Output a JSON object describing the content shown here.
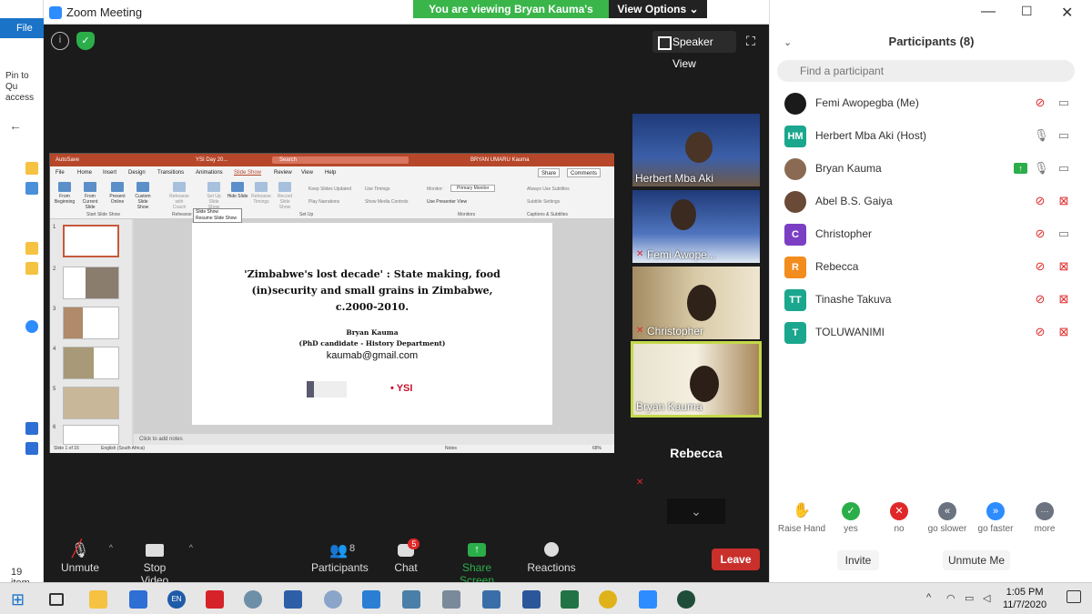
{
  "window": {
    "title": "Zoom Meeting",
    "viewing_banner": "You are viewing Bryan Kauma's screen",
    "view_options": "View Options"
  },
  "explorer": {
    "file_tab": "File",
    "pin_label": "Pin to Qu access",
    "items_count": "19 item"
  },
  "stage": {
    "speaker_view": "Speaker View"
  },
  "ppt": {
    "autosave": "AutoSave",
    "doc_title": "YSI Day 20...",
    "search": "Search",
    "user": "BRYAN UMARU Kauma",
    "menu": [
      "File",
      "Home",
      "Insert",
      "Design",
      "Transitions",
      "Animations",
      "Slide Show",
      "Review",
      "View",
      "Help"
    ],
    "share": "Share",
    "comments": "Comments",
    "ribbon": {
      "from_beginning": "From Beginning",
      "from_current": "From Current Slide",
      "present_online": "Present Online",
      "custom_show": "Custom Slide Show",
      "rehearse_coach": "Rehearse with Coach",
      "setup": "Set Up Slide Show",
      "hide": "Hide Slide",
      "rehearse_timings": "Rehearse Timings",
      "record": "Record Slide Show",
      "keep_updated": "Keep Slides Updated",
      "play_narrations": "Play Narrations",
      "use_timings": "Use Timings",
      "show_media": "Show Media Controls",
      "monitor": "Monitor:",
      "monitor_value": "Primary Monitor",
      "presenter_view": "Use Presenter View",
      "always_subtitles": "Always Use Subtitles",
      "subtitle_settings": "Subtitle Settings",
      "grp_start": "Start Slide Show",
      "grp_rehearse": "Rehearse",
      "grp_setup": "Set Up",
      "grp_monitors": "Monitors",
      "grp_captions": "Captions & Subtitles"
    },
    "popup": {
      "title": "Slide Show",
      "item": "Resume Slide Show"
    },
    "thumb_numbers": [
      "1",
      "2",
      "3",
      "4",
      "5",
      "6"
    ],
    "slide": {
      "title_line1": "'Zimbabwe's lost decade' : State making, food",
      "title_line2": "(in)security and small grains in Zimbabwe,",
      "title_line3": "c.2000-2010.",
      "author": "Bryan Kauma",
      "affiliation": "(PhD candidate - History Department)",
      "email": "kaumab@gmail.com",
      "logo2": "YSI"
    },
    "notes_placeholder": "Click to add notes",
    "status_slide": "Slide 1 of 16",
    "status_lang": "English (South Africa)",
    "status_notes": "Notes",
    "status_zoom": "68%"
  },
  "videos": [
    {
      "name": "Herbert Mba Aki"
    },
    {
      "name": "Femi Awope..."
    },
    {
      "name": "Christopher"
    },
    {
      "name": "Bryan Kauma"
    },
    {
      "name": "Rebecca"
    }
  ],
  "toolbar": {
    "unmute": "Unmute",
    "stop_video": "Stop Video",
    "participants": "Participants",
    "participants_count": "8",
    "chat": "Chat",
    "chat_badge": "5",
    "share_screen": "Share Screen",
    "reactions": "Reactions",
    "leave": "Leave"
  },
  "panel": {
    "title": "Participants (8)",
    "search_placeholder": "Find a participant",
    "participants": [
      {
        "name": "Femi Awopegba (Me)",
        "initials": "",
        "color": "#1a1a1a",
        "mic": "muted",
        "cam": "on"
      },
      {
        "name": "Herbert Mba Aki (Host)",
        "initials": "HM",
        "color": "#1aa78d",
        "mic": "on",
        "cam": "on"
      },
      {
        "name": "Bryan Kauma",
        "initials": "",
        "color": "#8a6a52",
        "mic": "on",
        "cam": "on",
        "sharing": true
      },
      {
        "name": "Abel B.S. Gaiya",
        "initials": "",
        "color": "#6a4a36",
        "mic": "muted",
        "cam": "off"
      },
      {
        "name": "Christopher",
        "initials": "C",
        "color": "#7b3fc4",
        "mic": "muted",
        "cam": "on"
      },
      {
        "name": "Rebecca",
        "initials": "R",
        "color": "#f28c1c",
        "mic": "muted",
        "cam": "off"
      },
      {
        "name": "Tinashe Takuva",
        "initials": "TT",
        "color": "#1aa78d",
        "mic": "muted",
        "cam": "off"
      },
      {
        "name": "TOLUWANIMI",
        "initials": "T",
        "color": "#1aa78d",
        "mic": "muted",
        "cam": "off"
      }
    ],
    "feedback": [
      {
        "label": "Raise Hand",
        "color": "#2d8cff",
        "glyph": "✋"
      },
      {
        "label": "yes",
        "color": "#2bae4a",
        "glyph": "✓"
      },
      {
        "label": "no",
        "color": "#e02828",
        "glyph": "✕"
      },
      {
        "label": "go slower",
        "color": "#6b7280",
        "glyph": "«"
      },
      {
        "label": "go faster",
        "color": "#2d8cff",
        "glyph": "»"
      },
      {
        "label": "more",
        "color": "#6b7280",
        "glyph": "···"
      }
    ],
    "invite": "Invite",
    "unmute_me": "Unmute Me"
  },
  "taskbar": {
    "lang": "EN",
    "time": "1:05 PM",
    "date": "11/7/2020"
  },
  "colors": {
    "zoom_blue": "#2d8cff",
    "share_green": "#2bae4a",
    "leave_red": "#c9302c",
    "mute_red": "#e02828"
  }
}
